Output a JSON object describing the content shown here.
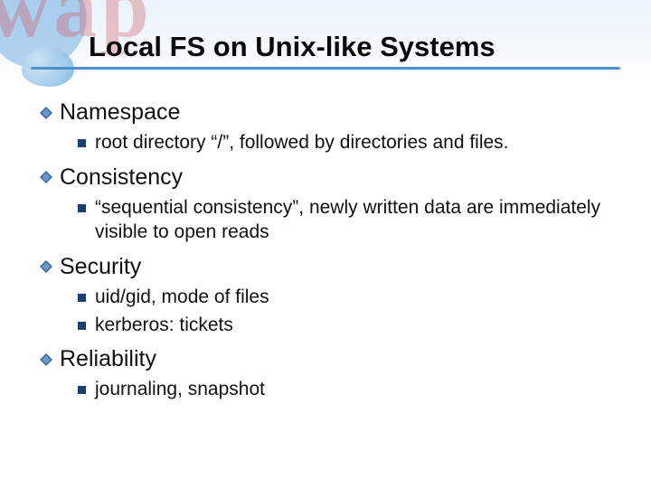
{
  "decor": {
    "bg_letters": "wap"
  },
  "title": "Local FS on Unix-like Systems",
  "sections": [
    {
      "heading": "Namespace",
      "items": [
        "root directory “/”, followed by directories and files."
      ]
    },
    {
      "heading": "Consistency",
      "items": [
        "“sequential consistency”, newly written data are immediately visible to open reads"
      ]
    },
    {
      "heading": "Security",
      "items": [
        "uid/gid, mode of files",
        "kerberos: tickets"
      ]
    },
    {
      "heading": "Reliability",
      "items": [
        "journaling, snapshot"
      ]
    }
  ],
  "colors": {
    "underline": "#4f8fca",
    "bullet_diamond": "#3d6aa3",
    "bullet_square": "#1b3f73"
  }
}
